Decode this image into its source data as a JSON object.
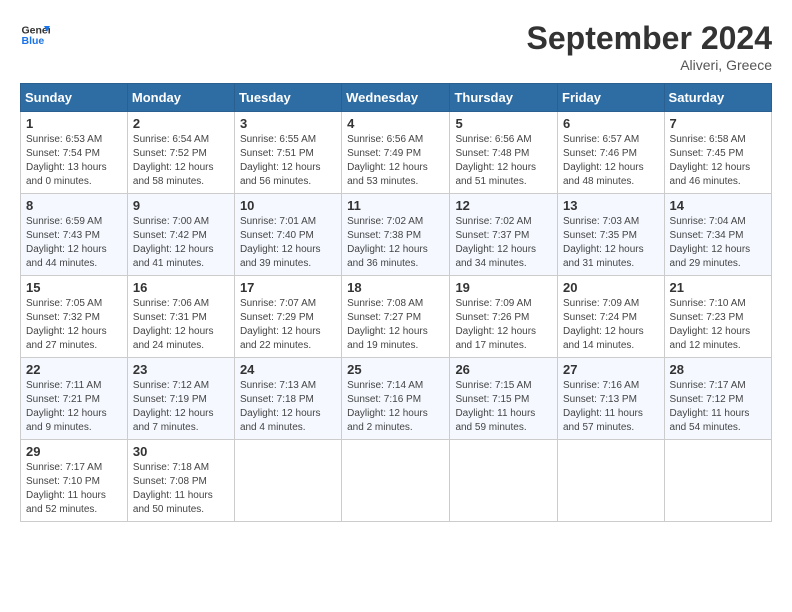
{
  "header": {
    "logo_line1": "General",
    "logo_line2": "Blue",
    "month_title": "September 2024",
    "location": "Aliveri, Greece"
  },
  "days_of_week": [
    "Sunday",
    "Monday",
    "Tuesday",
    "Wednesday",
    "Thursday",
    "Friday",
    "Saturday"
  ],
  "weeks": [
    [
      {
        "num": "1",
        "info": "Sunrise: 6:53 AM\nSunset: 7:54 PM\nDaylight: 13 hours\nand 0 minutes."
      },
      {
        "num": "2",
        "info": "Sunrise: 6:54 AM\nSunset: 7:52 PM\nDaylight: 12 hours\nand 58 minutes."
      },
      {
        "num": "3",
        "info": "Sunrise: 6:55 AM\nSunset: 7:51 PM\nDaylight: 12 hours\nand 56 minutes."
      },
      {
        "num": "4",
        "info": "Sunrise: 6:56 AM\nSunset: 7:49 PM\nDaylight: 12 hours\nand 53 minutes."
      },
      {
        "num": "5",
        "info": "Sunrise: 6:56 AM\nSunset: 7:48 PM\nDaylight: 12 hours\nand 51 minutes."
      },
      {
        "num": "6",
        "info": "Sunrise: 6:57 AM\nSunset: 7:46 PM\nDaylight: 12 hours\nand 48 minutes."
      },
      {
        "num": "7",
        "info": "Sunrise: 6:58 AM\nSunset: 7:45 PM\nDaylight: 12 hours\nand 46 minutes."
      }
    ],
    [
      {
        "num": "8",
        "info": "Sunrise: 6:59 AM\nSunset: 7:43 PM\nDaylight: 12 hours\nand 44 minutes."
      },
      {
        "num": "9",
        "info": "Sunrise: 7:00 AM\nSunset: 7:42 PM\nDaylight: 12 hours\nand 41 minutes."
      },
      {
        "num": "10",
        "info": "Sunrise: 7:01 AM\nSunset: 7:40 PM\nDaylight: 12 hours\nand 39 minutes."
      },
      {
        "num": "11",
        "info": "Sunrise: 7:02 AM\nSunset: 7:38 PM\nDaylight: 12 hours\nand 36 minutes."
      },
      {
        "num": "12",
        "info": "Sunrise: 7:02 AM\nSunset: 7:37 PM\nDaylight: 12 hours\nand 34 minutes."
      },
      {
        "num": "13",
        "info": "Sunrise: 7:03 AM\nSunset: 7:35 PM\nDaylight: 12 hours\nand 31 minutes."
      },
      {
        "num": "14",
        "info": "Sunrise: 7:04 AM\nSunset: 7:34 PM\nDaylight: 12 hours\nand 29 minutes."
      }
    ],
    [
      {
        "num": "15",
        "info": "Sunrise: 7:05 AM\nSunset: 7:32 PM\nDaylight: 12 hours\nand 27 minutes."
      },
      {
        "num": "16",
        "info": "Sunrise: 7:06 AM\nSunset: 7:31 PM\nDaylight: 12 hours\nand 24 minutes."
      },
      {
        "num": "17",
        "info": "Sunrise: 7:07 AM\nSunset: 7:29 PM\nDaylight: 12 hours\nand 22 minutes."
      },
      {
        "num": "18",
        "info": "Sunrise: 7:08 AM\nSunset: 7:27 PM\nDaylight: 12 hours\nand 19 minutes."
      },
      {
        "num": "19",
        "info": "Sunrise: 7:09 AM\nSunset: 7:26 PM\nDaylight: 12 hours\nand 17 minutes."
      },
      {
        "num": "20",
        "info": "Sunrise: 7:09 AM\nSunset: 7:24 PM\nDaylight: 12 hours\nand 14 minutes."
      },
      {
        "num": "21",
        "info": "Sunrise: 7:10 AM\nSunset: 7:23 PM\nDaylight: 12 hours\nand 12 minutes."
      }
    ],
    [
      {
        "num": "22",
        "info": "Sunrise: 7:11 AM\nSunset: 7:21 PM\nDaylight: 12 hours\nand 9 minutes."
      },
      {
        "num": "23",
        "info": "Sunrise: 7:12 AM\nSunset: 7:19 PM\nDaylight: 12 hours\nand 7 minutes."
      },
      {
        "num": "24",
        "info": "Sunrise: 7:13 AM\nSunset: 7:18 PM\nDaylight: 12 hours\nand 4 minutes."
      },
      {
        "num": "25",
        "info": "Sunrise: 7:14 AM\nSunset: 7:16 PM\nDaylight: 12 hours\nand 2 minutes."
      },
      {
        "num": "26",
        "info": "Sunrise: 7:15 AM\nSunset: 7:15 PM\nDaylight: 11 hours\nand 59 minutes."
      },
      {
        "num": "27",
        "info": "Sunrise: 7:16 AM\nSunset: 7:13 PM\nDaylight: 11 hours\nand 57 minutes."
      },
      {
        "num": "28",
        "info": "Sunrise: 7:17 AM\nSunset: 7:12 PM\nDaylight: 11 hours\nand 54 minutes."
      }
    ],
    [
      {
        "num": "29",
        "info": "Sunrise: 7:17 AM\nSunset: 7:10 PM\nDaylight: 11 hours\nand 52 minutes."
      },
      {
        "num": "30",
        "info": "Sunrise: 7:18 AM\nSunset: 7:08 PM\nDaylight: 11 hours\nand 50 minutes."
      },
      {
        "num": "",
        "info": ""
      },
      {
        "num": "",
        "info": ""
      },
      {
        "num": "",
        "info": ""
      },
      {
        "num": "",
        "info": ""
      },
      {
        "num": "",
        "info": ""
      }
    ]
  ]
}
